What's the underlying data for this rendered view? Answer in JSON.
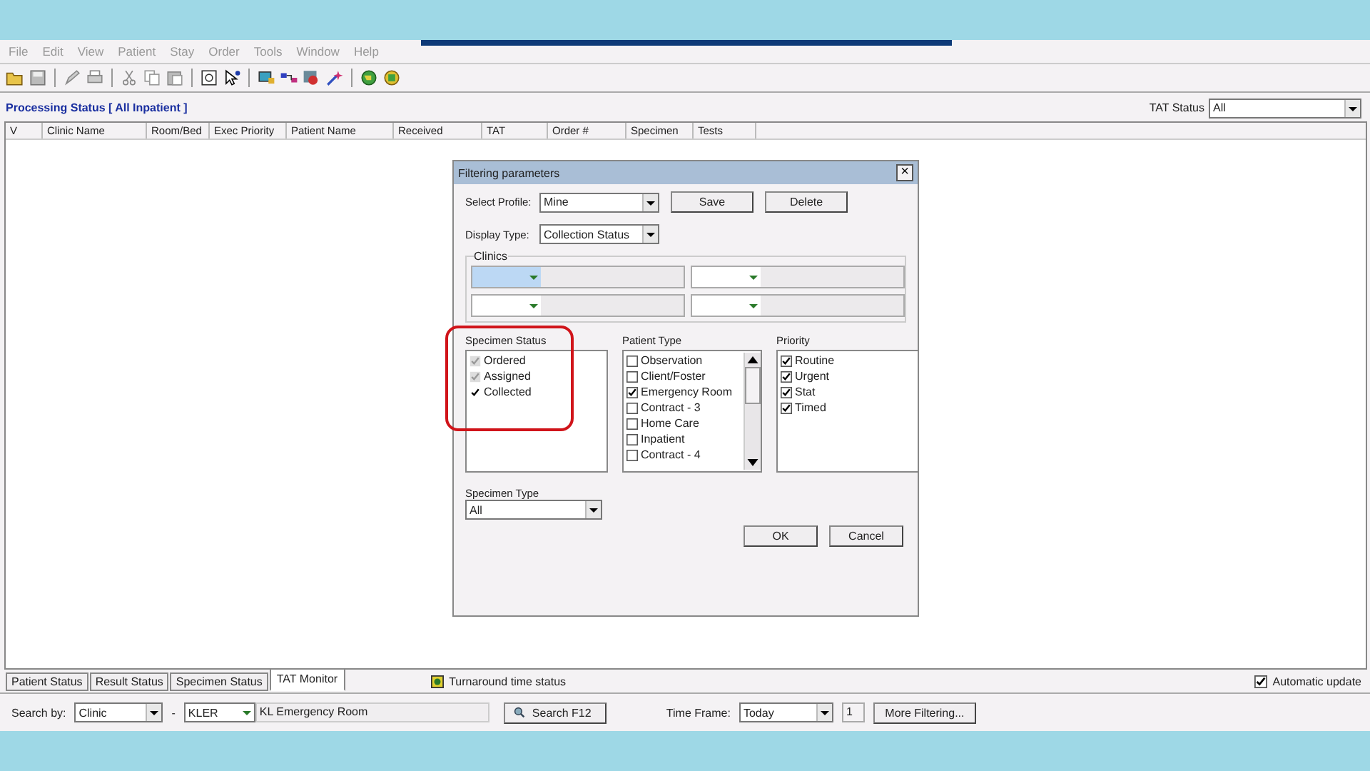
{
  "menu": [
    "File",
    "Edit",
    "View",
    "Patient",
    "Stay",
    "Order",
    "Tools",
    "Window",
    "Help"
  ],
  "header": {
    "title": "Processing Status [ All Inpatient ]",
    "tat_label": "TAT Status",
    "tat_value": "All"
  },
  "columns": [
    "V",
    "Clinic Name",
    "Room/Bed",
    "Exec Priority",
    "Patient Name",
    "Received",
    "TAT",
    "Order #",
    "Specimen",
    "Tests"
  ],
  "dialog": {
    "title": "Filtering parameters",
    "close": "×",
    "profile_label": "Select Profile:",
    "profile_value": "Mine",
    "save": "Save",
    "delete": "Delete",
    "display_label": "Display Type:",
    "display_value": "Collection Status",
    "clinics_label": "Clinics",
    "clinics": [
      {
        "selected": true
      },
      {
        "selected": false
      },
      {
        "selected": false
      },
      {
        "selected": false
      }
    ],
    "specimen_status": {
      "label": "Specimen Status",
      "items": [
        {
          "label": "Ordered",
          "checked": true,
          "disabled": true
        },
        {
          "label": "Assigned",
          "checked": true,
          "disabled": true
        },
        {
          "label": "Collected",
          "checked": true,
          "disabled": false
        }
      ]
    },
    "patient_type": {
      "label": "Patient Type",
      "items": [
        {
          "label": "Observation",
          "checked": false
        },
        {
          "label": "Client/Foster",
          "checked": false
        },
        {
          "label": "Emergency Room",
          "checked": true
        },
        {
          "label": "Contract - 3",
          "checked": false
        },
        {
          "label": "Home Care",
          "checked": false
        },
        {
          "label": "Inpatient",
          "checked": false
        },
        {
          "label": "Contract - 4",
          "checked": false
        }
      ]
    },
    "priority": {
      "label": "Priority",
      "items": [
        {
          "label": "Routine",
          "checked": true
        },
        {
          "label": "Urgent",
          "checked": true
        },
        {
          "label": "Stat",
          "checked": true
        },
        {
          "label": "Timed",
          "checked": true
        }
      ]
    },
    "specimen_type_label": "Specimen Type",
    "specimen_type_value": "All",
    "ok": "OK",
    "cancel": "Cancel"
  },
  "tabs": [
    {
      "label": "Patient Status",
      "selected": false
    },
    {
      "label": "Result Status",
      "selected": false
    },
    {
      "label": "Specimen Status",
      "selected": false
    },
    {
      "label": "TAT Monitor",
      "selected": true
    }
  ],
  "legend": "Turnaround time status",
  "auto_update": {
    "label": "Automatic update",
    "checked": true
  },
  "search": {
    "label": "Search by:",
    "by": "Clinic",
    "dash": "-",
    "code": "KLER",
    "code_name": "KL Emergency Room",
    "button": "Search F12",
    "time_label": "Time Frame:",
    "time_value": "Today",
    "count": "1",
    "more": "More Filtering..."
  }
}
